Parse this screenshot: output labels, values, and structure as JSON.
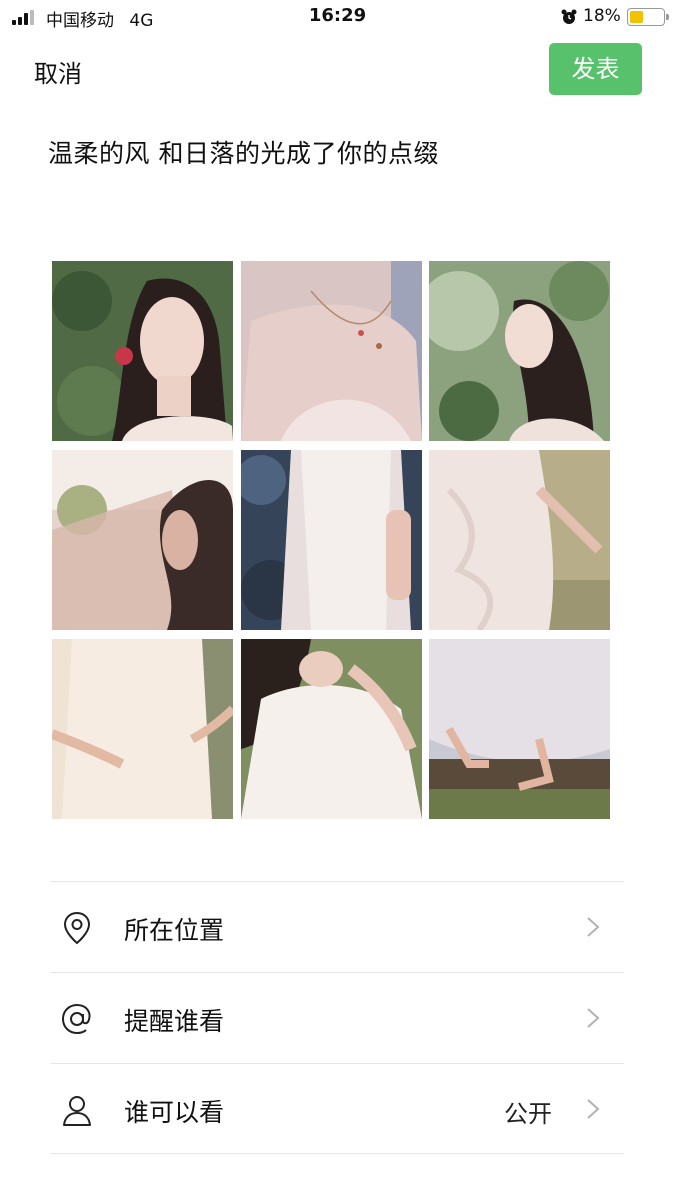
{
  "status_bar": {
    "carrier": "中国移动",
    "network": "4G",
    "time": "16:29",
    "battery_percent": "18%",
    "battery_level": 0.18
  },
  "nav": {
    "cancel_label": "取消",
    "publish_label": "发表",
    "publish_color": "#57c26b"
  },
  "post": {
    "text": "温柔的风 和日落的光成了你的点缀"
  },
  "photos": [
    {
      "name": "photo-1",
      "icon": "image"
    },
    {
      "name": "photo-2",
      "icon": "image"
    },
    {
      "name": "photo-3",
      "icon": "image"
    },
    {
      "name": "photo-4",
      "icon": "image"
    },
    {
      "name": "photo-5",
      "icon": "image"
    },
    {
      "name": "photo-6",
      "icon": "image"
    },
    {
      "name": "photo-7",
      "icon": "image"
    },
    {
      "name": "photo-8",
      "icon": "image"
    },
    {
      "name": "photo-9",
      "icon": "image"
    }
  ],
  "options": [
    {
      "label": "所在位置",
      "icon": "location-pin-icon",
      "value": ""
    },
    {
      "label": "提醒谁看",
      "icon": "at-sign-icon",
      "value": ""
    },
    {
      "label": "谁可以看",
      "icon": "person-icon",
      "value": "公开"
    }
  ]
}
